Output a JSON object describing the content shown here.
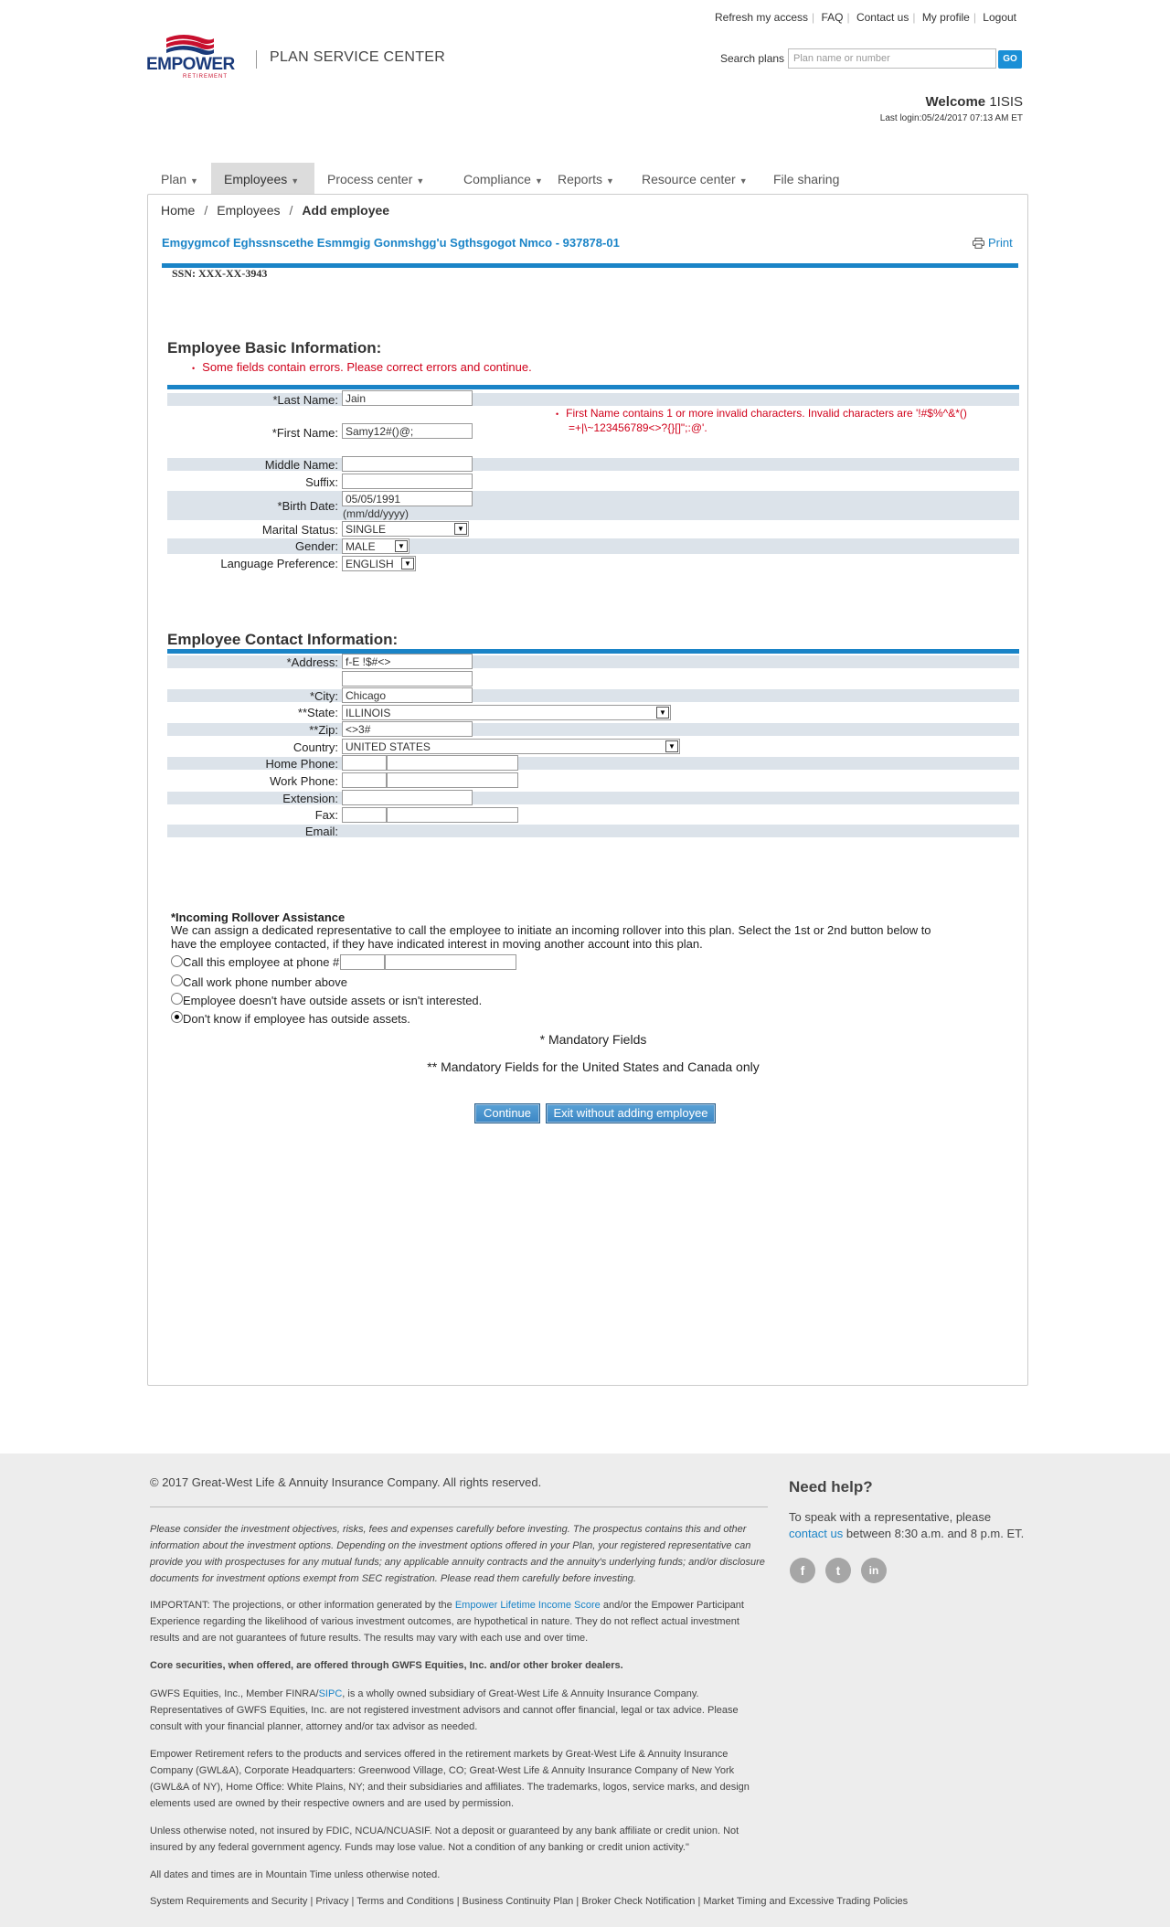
{
  "header": {
    "top_links": [
      "Refresh my access",
      "FAQ",
      "Contact us",
      "My profile",
      "Logout"
    ],
    "logo_text": "EMPOWER",
    "logo_sub": "RETIREMENT",
    "app_title": "PLAN SERVICE CENTER",
    "search_label": "Search plans",
    "search_placeholder": "Plan name or number",
    "search_go": "GO",
    "welcome_prefix": "Welcome",
    "welcome_user": "1ISIS",
    "last_login": "Last login:05/24/2017 07:13 AM ET"
  },
  "nav": [
    {
      "label": "Plan",
      "caret": true
    },
    {
      "label": "Employees",
      "caret": true,
      "active": true
    },
    {
      "label": "Process center",
      "caret": true
    },
    {
      "label": "Compliance",
      "caret": true
    },
    {
      "label": "Reports",
      "caret": true
    },
    {
      "label": "Resource center",
      "caret": true
    },
    {
      "label": "File sharing",
      "caret": false
    }
  ],
  "breadcrumb": {
    "home": "Home",
    "employees": "Employees",
    "current": "Add employee"
  },
  "plan_title": "Emgygmcof Eghssnscethe Esmmgig Gonmshgg'u Sgthsgogot Nmco - 937878-01",
  "print_label": "Print",
  "ssn": "SSN: XXX-XX-3943",
  "basic": {
    "heading": "Employee Basic Information:",
    "error_summary": "Some fields contain errors. Please correct errors and continue.",
    "first_name_error_line1": "First Name contains 1 or more invalid characters. Invalid characters are '!#$%^&*()",
    "first_name_error_line2": "=+|\\~123456789<>?{}[]\";:@'.",
    "labels": {
      "last_name": "*Last Name:",
      "first_name": "*First Name:",
      "middle_name": "Middle Name:",
      "suffix": "Suffix:",
      "birth_date": "*Birth Date:",
      "marital": "Marital Status:",
      "gender": "Gender:",
      "language": "Language Preference:"
    },
    "values": {
      "last_name": "Jain",
      "first_name": "Samy12#()@;",
      "middle_name": "",
      "suffix": "",
      "birth_date": "05/05/1991",
      "birth_hint": "(mm/dd/yyyy)",
      "marital": "SINGLE",
      "gender": "MALE",
      "language": "ENGLISH"
    }
  },
  "contact": {
    "heading": "Employee Contact Information:",
    "labels": {
      "address": "*Address:",
      "city": "*City:",
      "state": "**State:",
      "zip": "**Zip:",
      "country": "Country:",
      "home_phone": "Home Phone:",
      "work_phone": "Work Phone:",
      "extension": "Extension:",
      "fax": "Fax:",
      "email": "Email:"
    },
    "values": {
      "address1": "f-E !$#<>",
      "address2": "",
      "city": "Chicago",
      "state": "ILLINOIS",
      "zip": "<>3#",
      "country": "UNITED STATES"
    }
  },
  "rollover": {
    "heading": "*Incoming Rollover Assistance",
    "desc1": "We can assign a dedicated representative to call the employee to initiate an incoming rollover into this plan. Select the 1st or 2nd button below to",
    "desc2": "have the employee contacted, if they have indicated interest in moving another account into this plan.",
    "options": [
      "Call this employee at phone #",
      "Call work phone number above",
      "Employee doesn't have outside assets or isn't interested.",
      "Don't know if employee has outside assets."
    ],
    "selected_index": 3
  },
  "mandatory_note": "* Mandatory Fields",
  "mandatory_us_note": "** Mandatory Fields for the United States and Canada only",
  "buttons": {
    "continue": "Continue",
    "exit": "Exit without adding employee"
  },
  "footer": {
    "copyright": "© 2017 Great-West Life & Annuity Insurance Company. All rights reserved.",
    "disclaimer": [
      "Please consider the investment objectives, risks, fees and expenses carefully before investing. The prospectus contains this and other",
      "information about the investment options. Depending on the investment options offered in your Plan, your registered representative can",
      "provide you with prospectuses for any mutual funds; any applicable annuity contracts and the annuity's underlying funds; and/or disclosure",
      "documents for investment options exempt from SEC registration. Please read them carefully before investing."
    ],
    "important_pre": "IMPORTANT: The projections, or other information generated by the ",
    "important_link": "Empower Lifetime Income Score",
    "important_post": " and/or the Empower Participant",
    "important_rest": [
      "Experience regarding the likelihood of various investment outcomes, are hypothetical in nature. They do not reflect actual investment",
      "results and are not guarantees of future results. The results may vary with each use and over time."
    ],
    "core": "Core securities, when offered, are offered through GWFS Equities, Inc. and/or other broker dealers.",
    "gwfs_pre": "GWFS Equities, Inc., Member FINRA/",
    "gwfs_link": "SIPC",
    "gwfs_post": ", is a wholly owned subsidiary of Great-West Life & Annuity Insurance Company.",
    "gwfs_rest": [
      "Representatives of GWFS Equities, Inc. are not registered investment advisors and cannot offer financial, legal or tax advice. Please",
      "consult with your financial planner, attorney and/or tax advisor as needed."
    ],
    "empower": [
      "Empower Retirement refers to the products and services offered in the retirement markets by Great-West Life & Annuity Insurance",
      "Company (GWL&A), Corporate Headquarters: Greenwood Village, CO; Great-West Life & Annuity Insurance Company of New York",
      "(GWL&A of NY), Home Office: White Plains, NY; and their subsidiaries and affiliates. The trademarks, logos, service marks, and design",
      "elements used are owned by their respective owners and are used by permission."
    ],
    "fdic": [
      "Unless otherwise noted, not insured by FDIC, NCUA/NCUASIF. Not a deposit or guaranteed by any bank affiliate or credit union. Not",
      "insured by any federal government agency. Funds may lose value. Not a condition of any banking or credit union activity.\""
    ],
    "times": "All dates and times are in Mountain Time unless otherwise noted.",
    "bottom_links": [
      "System Requirements and Security",
      "Privacy",
      "Terms and Conditions",
      "Business Continuity Plan",
      "Broker Check Notification",
      "Market Timing and Excessive Trading Policies"
    ],
    "help_title": "Need help?",
    "help_line1": "To speak with a representative, please",
    "help_link": "contact us",
    "help_line2": " between 8:30 a.m. and 8 p.m. ET.",
    "social": [
      {
        "icon": "facebook-icon",
        "glyph": "f"
      },
      {
        "icon": "twitter-icon",
        "glyph": "t"
      },
      {
        "icon": "linkedin-icon",
        "glyph": "in"
      }
    ]
  }
}
